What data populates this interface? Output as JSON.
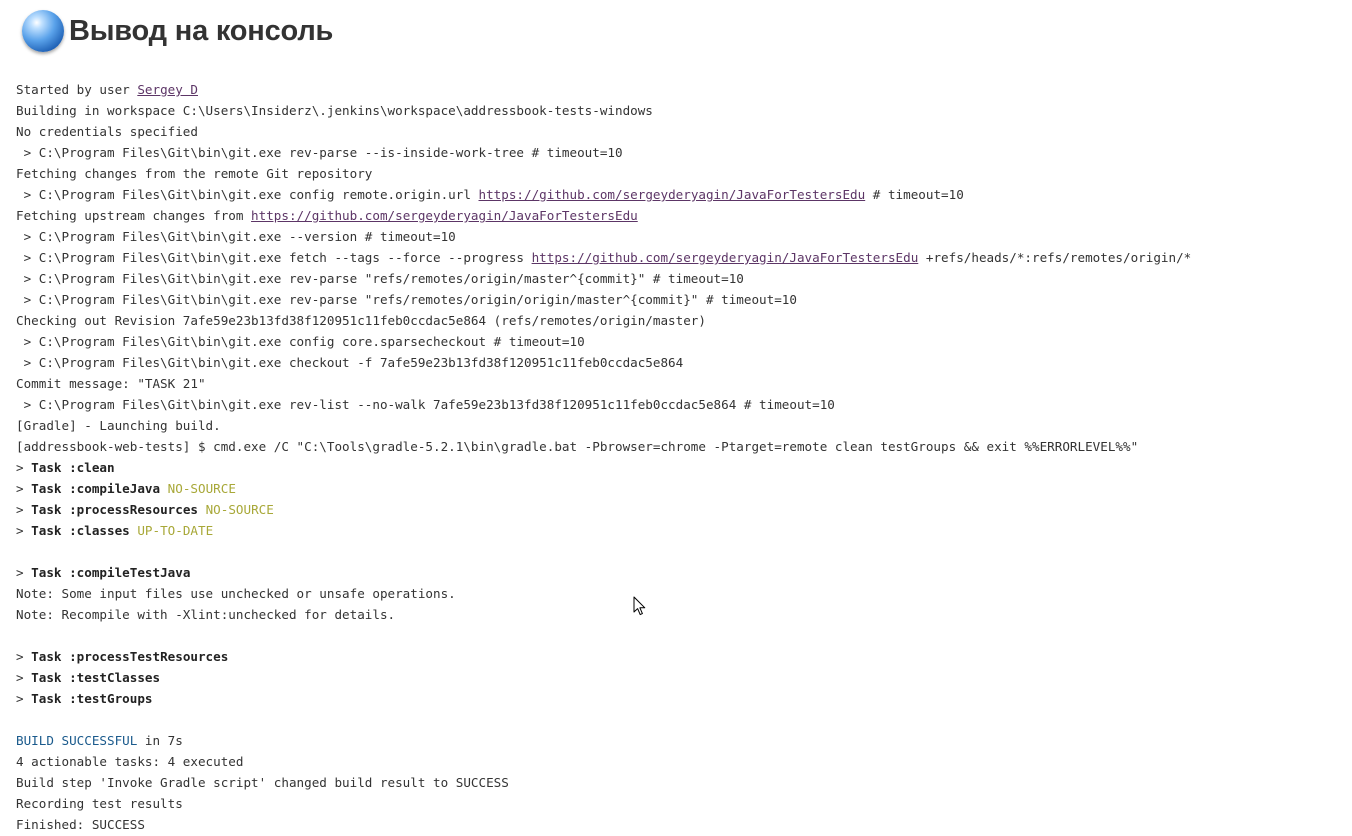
{
  "page": {
    "title": "Вывод на консоль"
  },
  "console": {
    "lines": [
      {
        "segments": [
          {
            "text": "Started by user "
          },
          {
            "text": "Sergey D",
            "style": "link"
          }
        ]
      },
      {
        "segments": [
          {
            "text": "Building in workspace C:\\Users\\Insiderz\\.jenkins\\workspace\\addressbook-tests-windows"
          }
        ]
      },
      {
        "segments": [
          {
            "text": "No credentials specified"
          }
        ]
      },
      {
        "segments": [
          {
            "text": " > C:\\Program Files\\Git\\bin\\git.exe rev-parse --is-inside-work-tree # timeout=10"
          }
        ]
      },
      {
        "segments": [
          {
            "text": "Fetching changes from the remote Git repository"
          }
        ]
      },
      {
        "segments": [
          {
            "text": " > C:\\Program Files\\Git\\bin\\git.exe config remote.origin.url "
          },
          {
            "text": "https://github.com/sergeyderyagin/JavaForTestersEdu",
            "style": "link"
          },
          {
            "text": " # timeout=10"
          }
        ]
      },
      {
        "segments": [
          {
            "text": "Fetching upstream changes from "
          },
          {
            "text": "https://github.com/sergeyderyagin/JavaForTestersEdu",
            "style": "link"
          }
        ]
      },
      {
        "segments": [
          {
            "text": " > C:\\Program Files\\Git\\bin\\git.exe --version # timeout=10"
          }
        ]
      },
      {
        "segments": [
          {
            "text": " > C:\\Program Files\\Git\\bin\\git.exe fetch --tags --force --progress "
          },
          {
            "text": "https://github.com/sergeyderyagin/JavaForTestersEdu",
            "style": "link"
          },
          {
            "text": " +refs/heads/*:refs/remotes/origin/*"
          }
        ]
      },
      {
        "segments": [
          {
            "text": " > C:\\Program Files\\Git\\bin\\git.exe rev-parse \"refs/remotes/origin/master^{commit}\" # timeout=10"
          }
        ]
      },
      {
        "segments": [
          {
            "text": " > C:\\Program Files\\Git\\bin\\git.exe rev-parse \"refs/remotes/origin/origin/master^{commit}\" # timeout=10"
          }
        ]
      },
      {
        "segments": [
          {
            "text": "Checking out Revision 7afe59e23b13fd38f120951c11feb0ccdac5e864 (refs/remotes/origin/master)"
          }
        ]
      },
      {
        "segments": [
          {
            "text": " > C:\\Program Files\\Git\\bin\\git.exe config core.sparsecheckout # timeout=10"
          }
        ]
      },
      {
        "segments": [
          {
            "text": " > C:\\Program Files\\Git\\bin\\git.exe checkout -f 7afe59e23b13fd38f120951c11feb0ccdac5e864"
          }
        ]
      },
      {
        "segments": [
          {
            "text": "Commit message: \"TASK 21\""
          }
        ]
      },
      {
        "segments": [
          {
            "text": " > C:\\Program Files\\Git\\bin\\git.exe rev-list --no-walk 7afe59e23b13fd38f120951c11feb0ccdac5e864 # timeout=10"
          }
        ]
      },
      {
        "segments": [
          {
            "text": "[Gradle] - Launching build."
          }
        ]
      },
      {
        "segments": [
          {
            "text": "[addressbook-web-tests] $ cmd.exe /C \"C:\\Tools\\gradle-5.2.1\\bin\\gradle.bat -Pbrowser=chrome -Ptarget=remote clean testGroups && exit %%ERRORLEVEL%%\""
          }
        ]
      },
      {
        "segments": [
          {
            "text": "> "
          },
          {
            "text": "Task :clean",
            "style": "bold"
          }
        ]
      },
      {
        "segments": [
          {
            "text": "> "
          },
          {
            "text": "Task :compileJava",
            "style": "bold"
          },
          {
            "text": " "
          },
          {
            "text": "NO-SOURCE",
            "style": "yellow"
          }
        ]
      },
      {
        "segments": [
          {
            "text": "> "
          },
          {
            "text": "Task :processResources",
            "style": "bold"
          },
          {
            "text": " "
          },
          {
            "text": "NO-SOURCE",
            "style": "yellow"
          }
        ]
      },
      {
        "segments": [
          {
            "text": "> "
          },
          {
            "text": "Task :classes",
            "style": "bold"
          },
          {
            "text": " "
          },
          {
            "text": "UP-TO-DATE",
            "style": "yellow"
          }
        ]
      },
      {
        "segments": [
          {
            "text": ""
          }
        ]
      },
      {
        "segments": [
          {
            "text": "> "
          },
          {
            "text": "Task :compileTestJava",
            "style": "bold"
          }
        ]
      },
      {
        "segments": [
          {
            "text": "Note: Some input files use unchecked or unsafe operations."
          }
        ]
      },
      {
        "segments": [
          {
            "text": "Note: Recompile with -Xlint:unchecked for details."
          }
        ]
      },
      {
        "segments": [
          {
            "text": ""
          }
        ]
      },
      {
        "segments": [
          {
            "text": "> "
          },
          {
            "text": "Task :processTestResources",
            "style": "bold"
          }
        ]
      },
      {
        "segments": [
          {
            "text": "> "
          },
          {
            "text": "Task :testClasses",
            "style": "bold"
          }
        ]
      },
      {
        "segments": [
          {
            "text": "> "
          },
          {
            "text": "Task :testGroups",
            "style": "bold"
          }
        ]
      },
      {
        "segments": [
          {
            "text": ""
          }
        ]
      },
      {
        "segments": [
          {
            "text": "BUILD SUCCESSFUL",
            "style": "blue"
          },
          {
            "text": " in 7s"
          }
        ]
      },
      {
        "segments": [
          {
            "text": "4 actionable tasks: 4 executed"
          }
        ]
      },
      {
        "segments": [
          {
            "text": "Build step 'Invoke Gradle script' changed build result to SUCCESS"
          }
        ]
      },
      {
        "segments": [
          {
            "text": "Recording test results"
          }
        ]
      },
      {
        "segments": [
          {
            "text": "Finished: SUCCESS"
          }
        ]
      }
    ]
  },
  "colors": {
    "text": "#333333",
    "link": "#5c3566",
    "ansi_yellow": "#a8a838",
    "ansi_blue": "#1a5a8c",
    "background": "#ffffff"
  },
  "icons": {
    "header_icon": "blue-ball-icon",
    "cursor": "mouse-pointer-icon"
  }
}
